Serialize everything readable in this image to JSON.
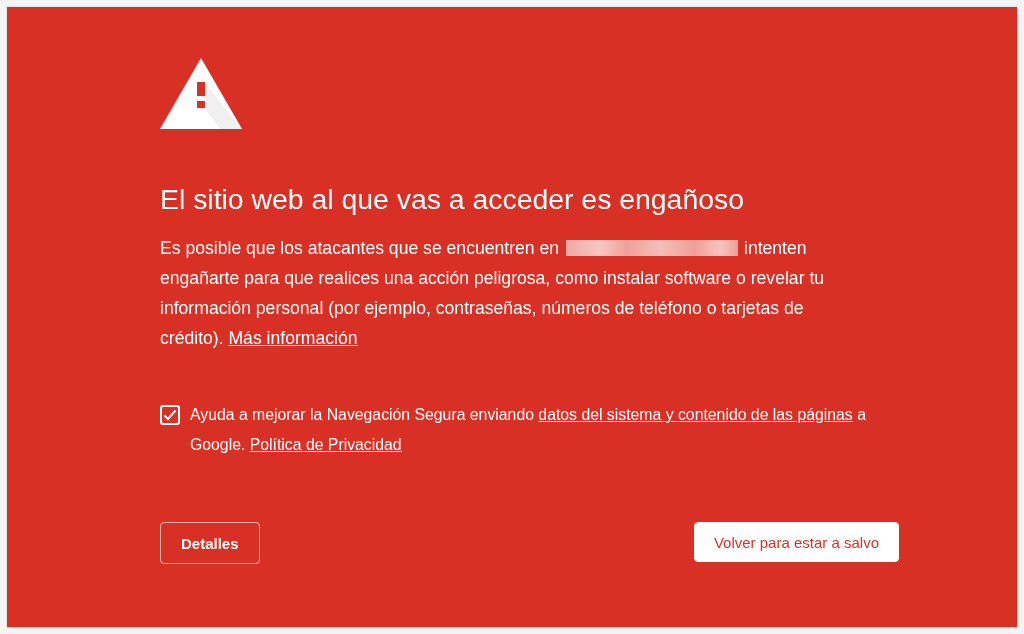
{
  "heading": "El sitio web al que vas a acceder es engañoso",
  "message": {
    "text_before": "Es posible que los atacantes que se encuentren en",
    "text_after": "intenten engañarte para que realices una acción peligrosa, como instalar software o revelar tu información personal (por ejemplo, contraseñas, números de teléfono o tarjetas de crédito).",
    "link": "Más información"
  },
  "consent": {
    "checked": true,
    "text_before": "Ayuda a mejorar la Navegación Segura enviando",
    "link": "datos del sistema y contenido de las páginas",
    "text_middle": "a Google.",
    "policy_link": "Política de Privacidad"
  },
  "buttons": [
    {
      "label": "Detalles",
      "kind": "secondary"
    },
    {
      "label": "Volver para estar a salvo",
      "kind": "primary"
    }
  ]
}
